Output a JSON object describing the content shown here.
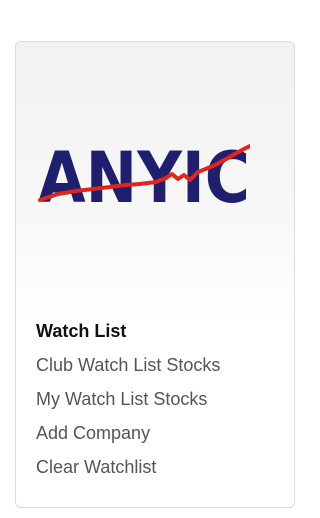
{
  "logo": {
    "text": "ANYIC",
    "text_color": "#1f1f6e",
    "line_color": "#e4241b"
  },
  "watchlist": {
    "heading": "Watch List",
    "items": [
      {
        "label": "Club Watch List Stocks"
      },
      {
        "label": "My Watch List Stocks"
      },
      {
        "label": "Add Company"
      },
      {
        "label": "Clear Watchlist"
      }
    ]
  }
}
